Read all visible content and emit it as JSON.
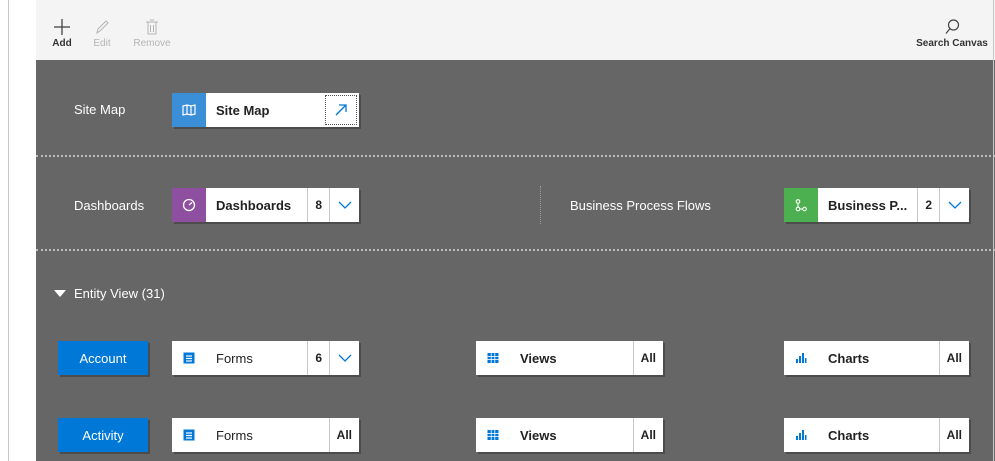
{
  "toolbar": {
    "add_label": "Add",
    "edit_label": "Edit",
    "remove_label": "Remove",
    "search_label": "Search Canvas"
  },
  "sitemap": {
    "row_label": "Site Map",
    "tile_title": "Site Map",
    "icon": "map-icon",
    "color": "#3a8fd8"
  },
  "dashboards": {
    "row_label": "Dashboards",
    "tile_title": "Dashboards",
    "count": "8",
    "icon": "gauge-icon",
    "color": "#8e4fa0"
  },
  "bpf": {
    "row_label": "Business Process Flows",
    "tile_title": "Business P...",
    "count": "2",
    "icon": "flow-icon",
    "color": "#4caf50"
  },
  "entity_view": {
    "header": "Entity View (31)",
    "rows": [
      {
        "entity": "Account",
        "forms": {
          "title": "Forms",
          "count": "6"
        },
        "views": {
          "title": "Views",
          "count": "All"
        },
        "charts": {
          "title": "Charts",
          "count": "All"
        }
      },
      {
        "entity": "Activity",
        "forms": {
          "title": "Forms",
          "count": "All"
        },
        "views": {
          "title": "Views",
          "count": "All"
        },
        "charts": {
          "title": "Charts",
          "count": "All"
        }
      }
    ]
  },
  "colors": {
    "entity_blue": "#0078d7",
    "icon_blue": "#0078d7",
    "canvas_gray": "#666666"
  }
}
